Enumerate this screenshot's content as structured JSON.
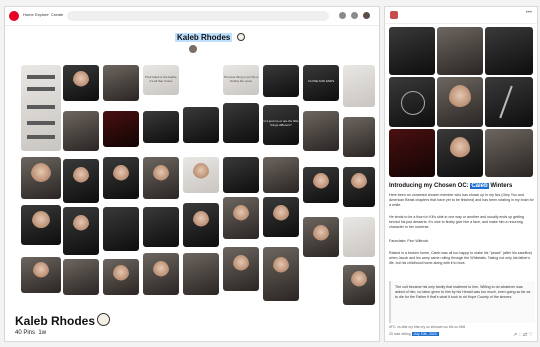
{
  "board_topbar": {
    "nav": [
      "Home",
      "Explore",
      "Create"
    ]
  },
  "board": {
    "title": "Kaleb Rhodes",
    "footer_name": "Kaleb Rhodes",
    "pins_count": "40 Pins",
    "age": "1w",
    "pin_texts": [
      "Their black is the fearlie, it's all that I know",
      "The best thing in our life is finding the mess",
      "Is it just me or are the little things different?",
      "CLOSE AND ENDS"
    ]
  },
  "post": {
    "heading_prefix": "Introducing my Chosen OC: ",
    "heading_highlight": "Caleb",
    "heading_suffix": " Winters",
    "para1": "Here been an unnamed chosen member who has shown up in my fics (Only You and American Beast chapters that have yet to be finished) and has been rotating in my brain for a while.",
    "para2": "He tends to be a thorn in Kit's side in one way or another and usually ends up getting served his just desserts. It's nice to finally give him a face, and make him a recurring character in her universe.",
    "para3": "Faceclaim: Finn Wittrock",
    "para4": "Raised in a broken home, Caleb was all too happy to make his \"peace\" (after his sacrifice) when Jacob and his army came rolling through the Whitetails. Taking not only his father's life, but his childhood home along with it to boot.",
    "reblog_text": "The cult became his only family that mattered to him. Willing to do whatever was asked of him, no labor given to him by his Herald was too much, even going so far as to die for the Father if that's what it took to rid Hope County of the sinners.",
    "tags_line1": "#FC: vs   #far cry   #far cry oc   #chosen oc   #fc oc   #fc5",
    "tags_line2": "33 note  reblog",
    "date": "July 10th, 2023"
  }
}
